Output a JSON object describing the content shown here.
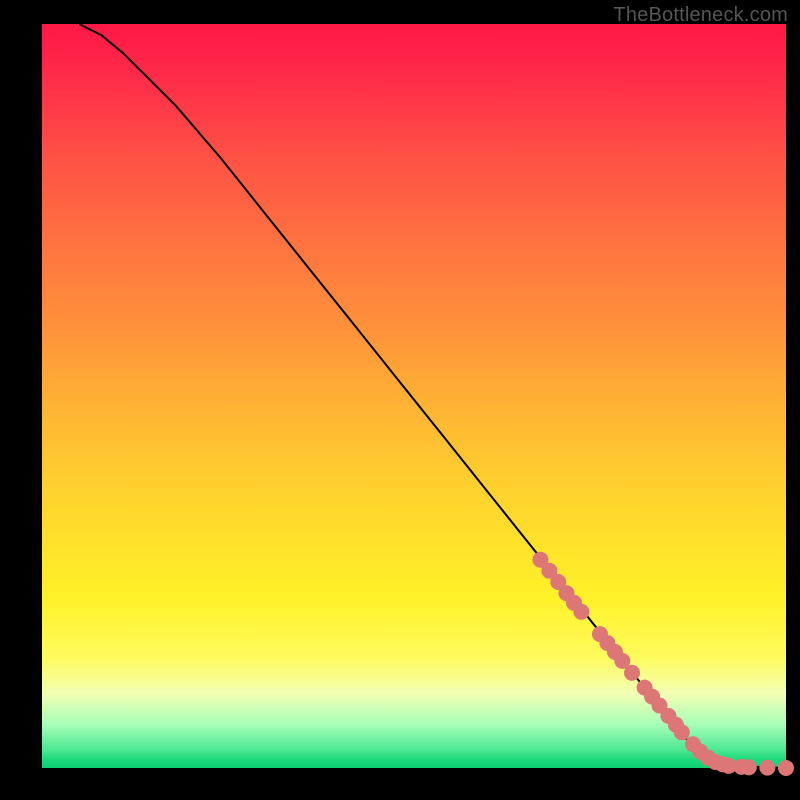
{
  "watermark": "TheBottleneck.com",
  "chart_data": {
    "type": "line",
    "title": "",
    "xlabel": "",
    "ylabel": "",
    "xlim": [
      0,
      100
    ],
    "ylim": [
      0,
      100
    ],
    "series": [
      {
        "name": "curve",
        "x": [
          5,
          8,
          11,
          14,
          18,
          24,
          30,
          36,
          42,
          48,
          54,
          60,
          66,
          72,
          78,
          82,
          86,
          88,
          90,
          92,
          94,
          96,
          98,
          100
        ],
        "y": [
          100,
          98.5,
          96,
          93,
          89,
          82,
          74.5,
          67,
          59.5,
          52,
          44.5,
          37,
          29.5,
          22,
          14.5,
          9.5,
          4.5,
          2.5,
          1.2,
          0.6,
          0.3,
          0.15,
          0.07,
          0
        ]
      }
    ],
    "markers": {
      "comment": "salmon-colored dots along the lower-right portion of the curve",
      "points": [
        {
          "x": 67,
          "y": 28
        },
        {
          "x": 68.2,
          "y": 26.5
        },
        {
          "x": 69.4,
          "y": 25
        },
        {
          "x": 70.5,
          "y": 23.5
        },
        {
          "x": 71.5,
          "y": 22.2
        },
        {
          "x": 72.5,
          "y": 21
        },
        {
          "x": 75,
          "y": 18
        },
        {
          "x": 76,
          "y": 16.8
        },
        {
          "x": 77,
          "y": 15.6
        },
        {
          "x": 78,
          "y": 14.4
        },
        {
          "x": 79.3,
          "y": 12.8
        },
        {
          "x": 81,
          "y": 10.8
        },
        {
          "x": 82,
          "y": 9.6
        },
        {
          "x": 83,
          "y": 8.4
        },
        {
          "x": 84.2,
          "y": 7
        },
        {
          "x": 85.2,
          "y": 5.8
        },
        {
          "x": 86,
          "y": 4.8
        },
        {
          "x": 87.5,
          "y": 3.2
        },
        {
          "x": 88.5,
          "y": 2.2
        },
        {
          "x": 89.5,
          "y": 1.4
        },
        {
          "x": 90.5,
          "y": 0.8
        },
        {
          "x": 91.5,
          "y": 0.5
        },
        {
          "x": 92.3,
          "y": 0.3
        },
        {
          "x": 94,
          "y": 0.15
        },
        {
          "x": 95,
          "y": 0.1
        },
        {
          "x": 97.5,
          "y": 0.05
        },
        {
          "x": 100,
          "y": 0
        }
      ],
      "color": "#d77",
      "radius_px": 8
    },
    "colors": {
      "line": "#000000",
      "background_top": "#ff1846",
      "background_bottom": "#0cd072"
    }
  }
}
